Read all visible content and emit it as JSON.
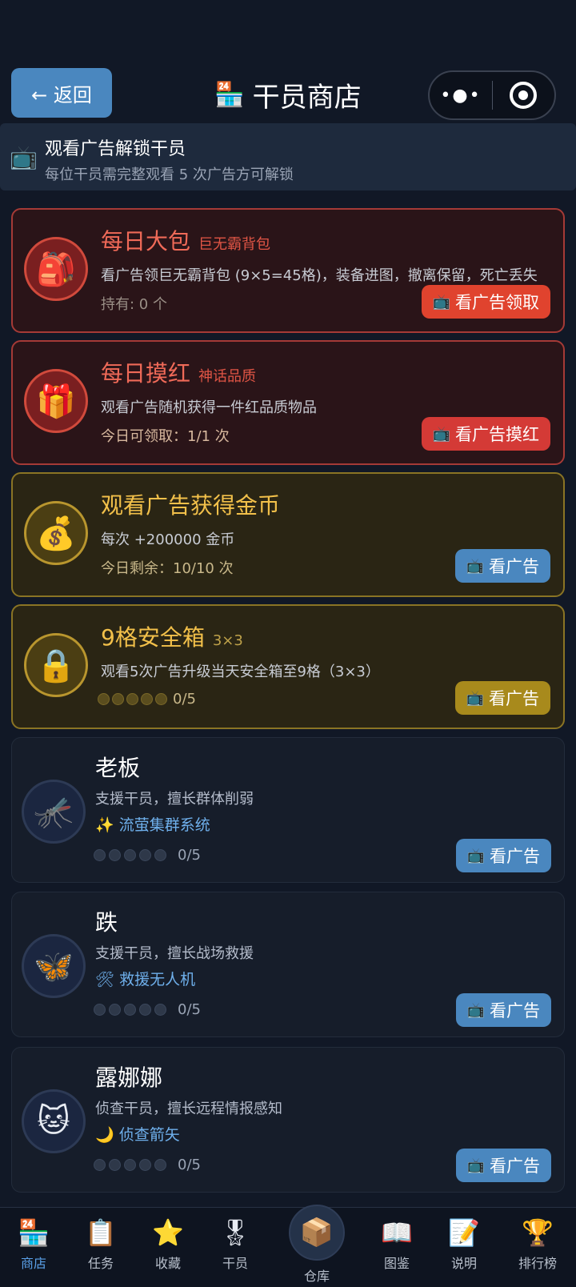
{
  "header": {
    "back_label": "← 返回",
    "title": "干员商店",
    "title_icon": "shop-24-icon"
  },
  "banner": {
    "title": "观看广告解锁干员",
    "subtitle": "每位干员需完整观看 5 次广告方可解锁"
  },
  "cards": {
    "daily_pack": {
      "title": "每日大包",
      "tag": "巨无霸背包",
      "desc": "看广告领巨无霸背包 (9×5=45格)，装备进图，撤离保留，死亡丢失",
      "meta": "持有: 0 个",
      "button": "看广告领取",
      "icon": "backpack-icon"
    },
    "daily_red": {
      "title": "每日摸红",
      "tag": "神话品质",
      "desc": "观看广告随机获得一件红品质物品",
      "meta": "今日可领取：1/1 次",
      "button": "看广告摸红",
      "icon": "gift-icon"
    },
    "coins": {
      "title": "观看广告获得金币",
      "desc": "每次 +200000 金币",
      "meta": "今日剩余：10/10 次",
      "button": "看广告",
      "icon": "money-bag-icon"
    },
    "safe_box": {
      "title": "9格安全箱",
      "tag": "3×3",
      "desc": "观看5次广告升级当天安全箱至9格（3×3）",
      "progress": "0/5",
      "button": "看广告",
      "icon": "lock-icon"
    }
  },
  "operators": [
    {
      "name": "老板",
      "desc": "支援干员，擅长群体削弱",
      "skill_emoji": "✨",
      "skill": "流萤集群系统",
      "progress": "0/5",
      "button": "看广告",
      "icon": "mosquito-icon"
    },
    {
      "name": "跌",
      "desc": "支援干员，擅长战场救援",
      "skill_emoji": "🛠",
      "skill": "救援无人机",
      "progress": "0/5",
      "button": "看广告",
      "icon": "butterfly-icon"
    },
    {
      "name": "露娜娜",
      "desc": "侦查干员，擅长远程情报感知",
      "skill_emoji": "🌙",
      "skill": "侦查箭矢",
      "progress": "0/5",
      "button": "看广告",
      "icon": "cat-icon"
    }
  ],
  "tabbar": {
    "items": [
      {
        "label": "商店",
        "icon": "shop-24-icon",
        "active": true
      },
      {
        "label": "任务",
        "icon": "clipboard-icon"
      },
      {
        "label": "收藏",
        "icon": "star-icon"
      },
      {
        "label": "干员",
        "icon": "medal-icon"
      },
      {
        "label": "仓库",
        "icon": "package-icon"
      },
      {
        "label": "图鉴",
        "icon": "book-icon"
      },
      {
        "label": "说明",
        "icon": "memo-icon"
      },
      {
        "label": "排行榜",
        "icon": "trophy-icon"
      }
    ]
  },
  "colors": {
    "accent_blue": "#4a87bf",
    "red_button": "#e0432e",
    "gold_button": "#a88a1c",
    "background": "#111826"
  }
}
